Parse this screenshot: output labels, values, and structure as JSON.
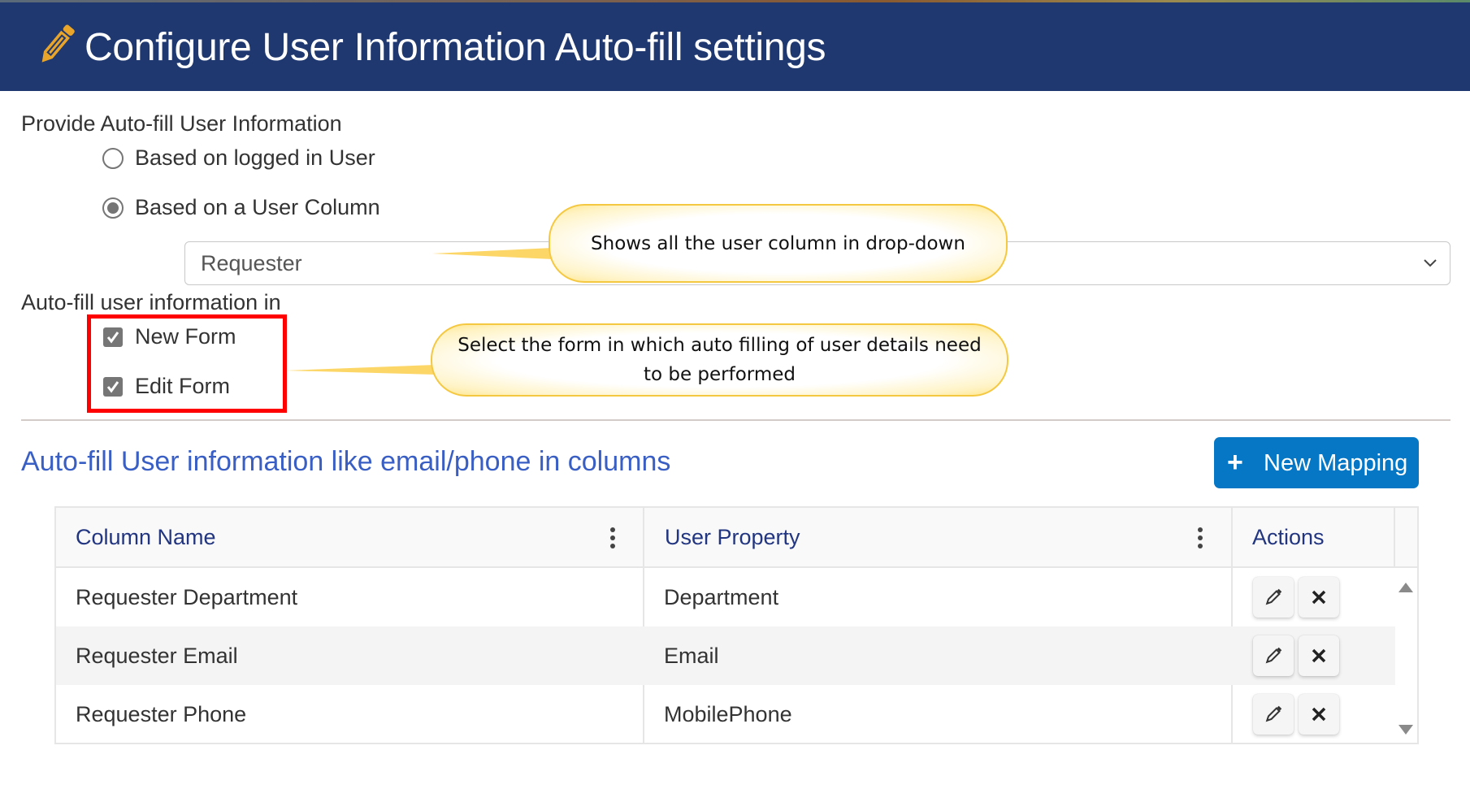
{
  "header": {
    "title": "Configure User Information Auto-fill settings",
    "icon": "pencil-icon",
    "bg_color": "#203870",
    "icon_color": "#e8a52a"
  },
  "provide": {
    "label": "Provide Auto-fill User Information",
    "options": [
      {
        "label": "Based on logged in User",
        "checked": false
      },
      {
        "label": "Based on a User Column",
        "checked": true
      }
    ],
    "user_column_select": {
      "value": "Requester"
    }
  },
  "autofill_in": {
    "label": "Auto-fill user information in",
    "options": [
      {
        "label": "New Form",
        "checked": true
      },
      {
        "label": "Edit Form",
        "checked": true
      }
    ]
  },
  "callouts": [
    {
      "text": "Shows all the user column in drop-down"
    },
    {
      "text": "Select the form in which auto filling of user details need to be performed"
    }
  ],
  "mapping": {
    "title": "Auto-fill User information like email/phone in columns",
    "new_button_label": "New Mapping",
    "new_button_icon": "plus-icon",
    "accent_color": "#0577c4",
    "columns": [
      "Column Name",
      "User Property",
      "Actions"
    ],
    "rows": [
      {
        "column_name": "Requester Department",
        "user_property": "Department"
      },
      {
        "column_name": "Requester Email",
        "user_property": "Email"
      },
      {
        "column_name": "Requester Phone",
        "user_property": "MobilePhone"
      }
    ]
  }
}
